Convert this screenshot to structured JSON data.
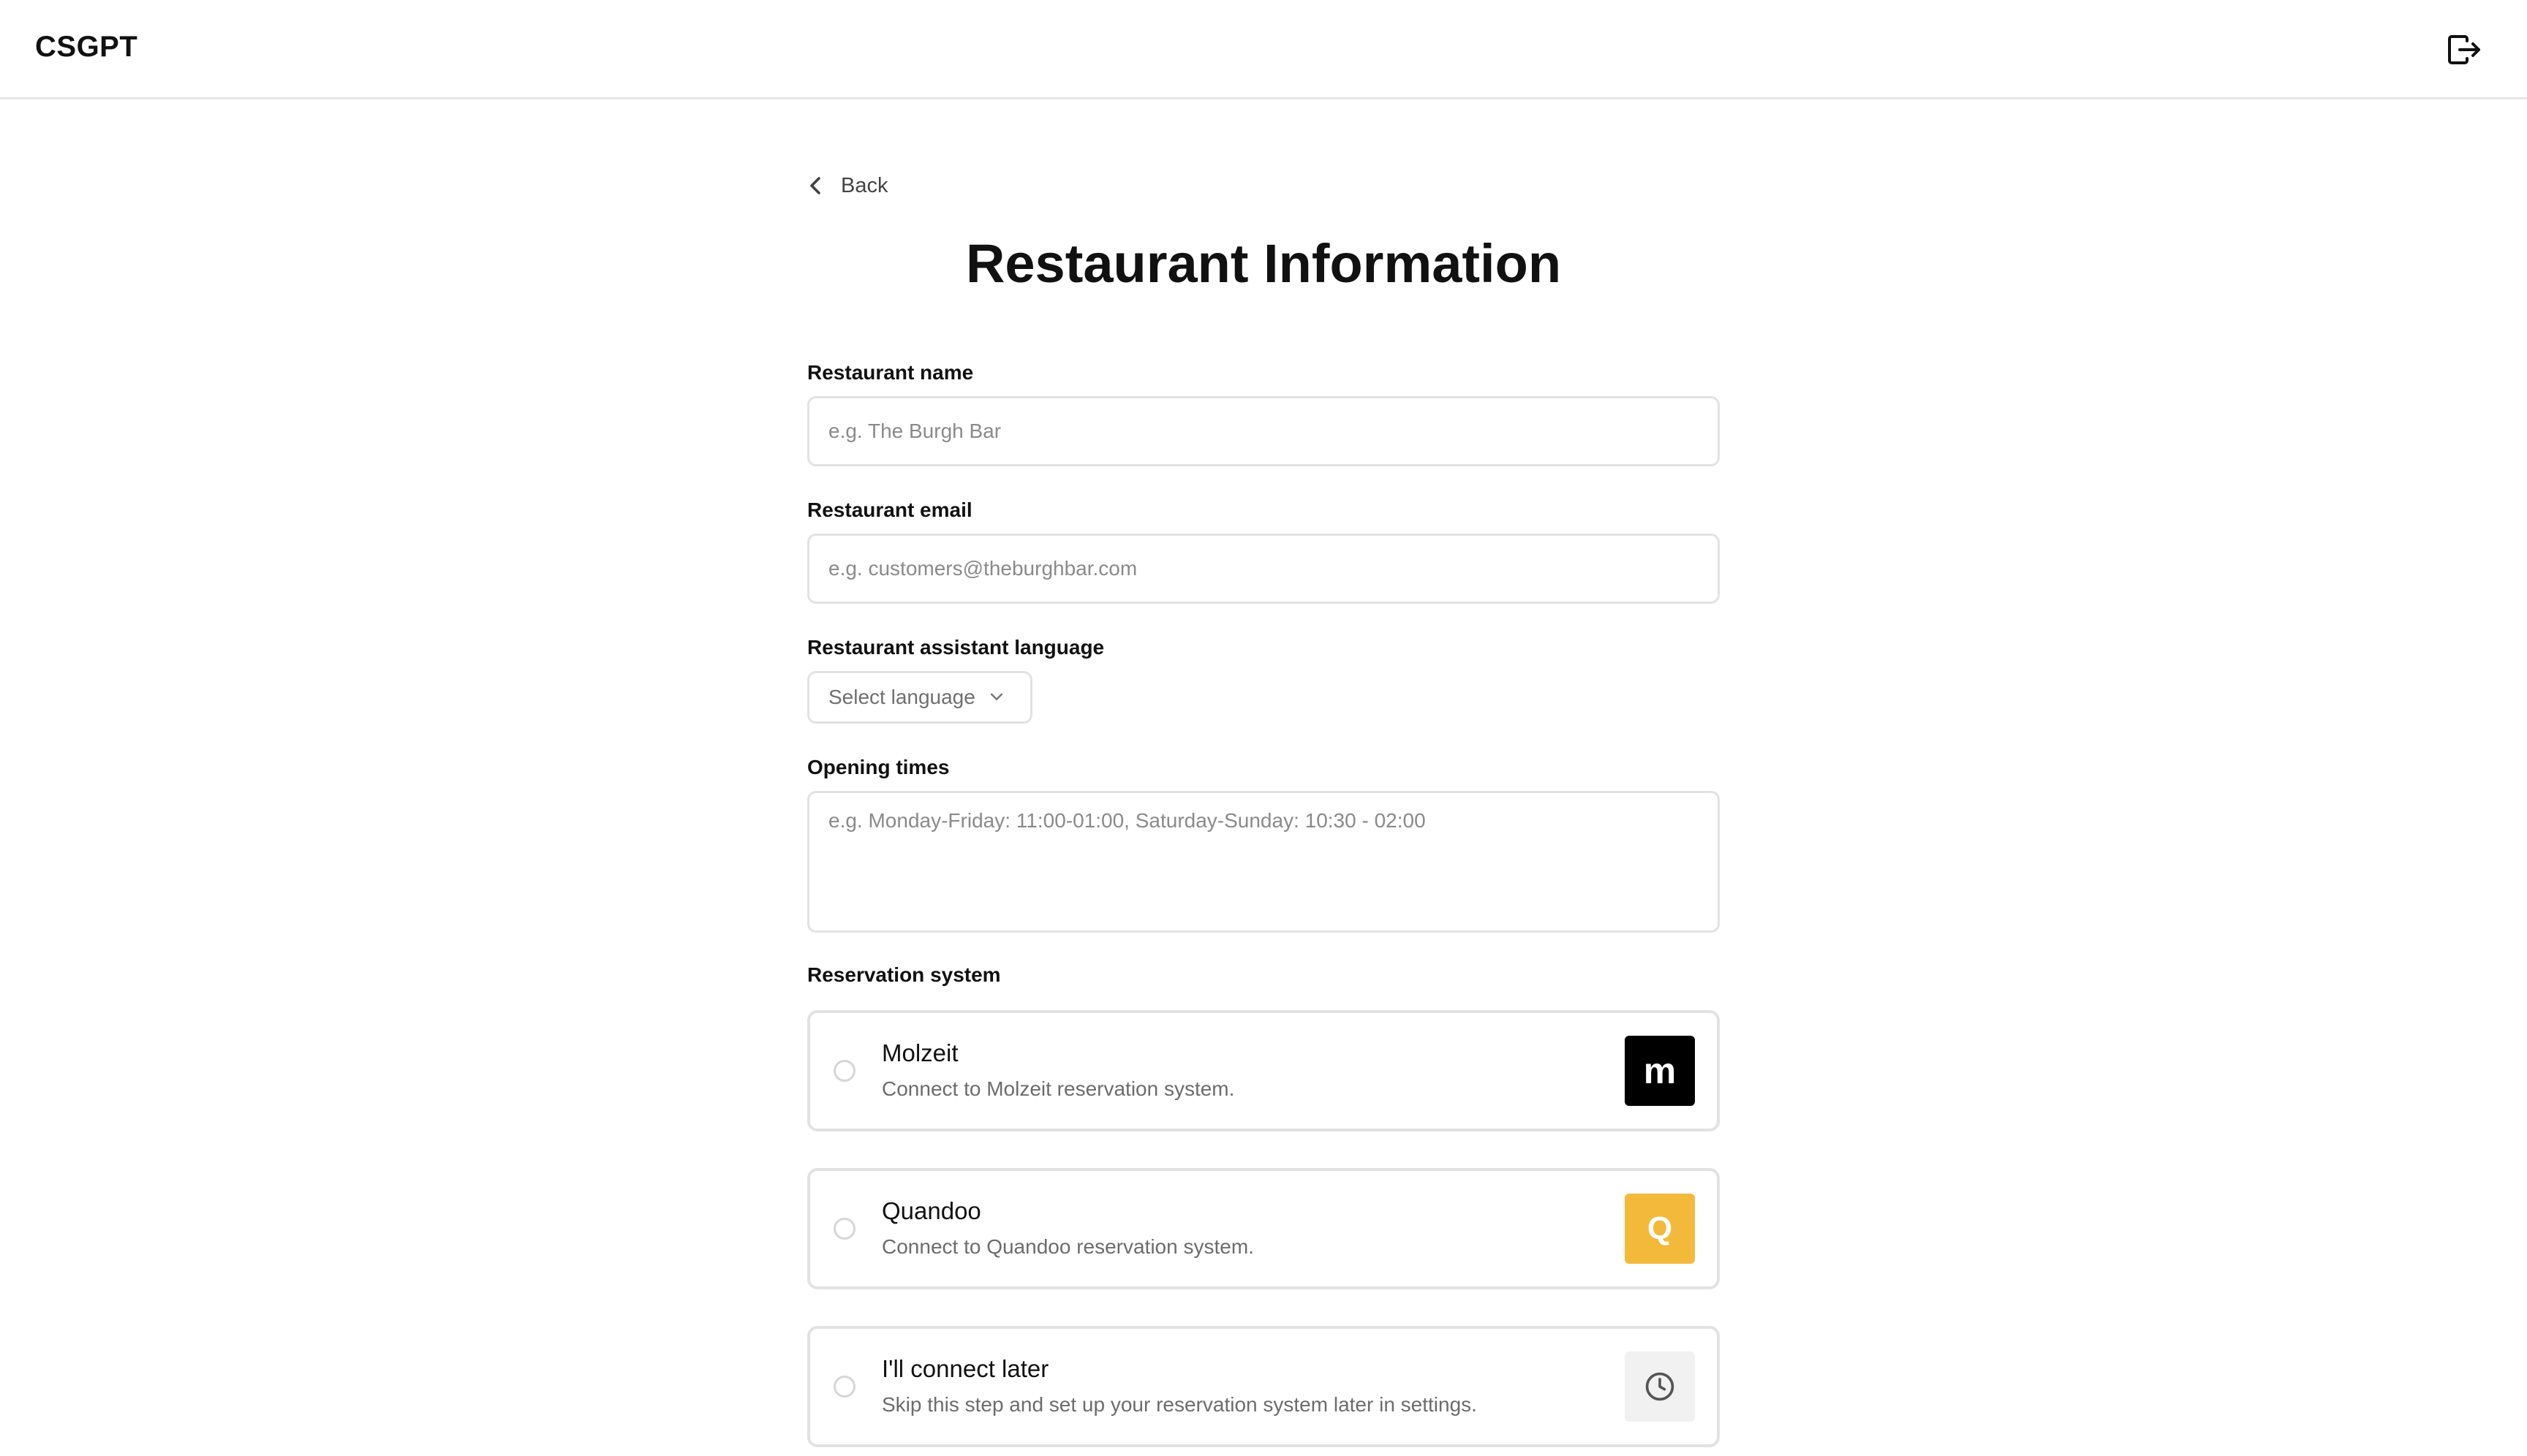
{
  "header": {
    "brand": "CSGPT",
    "logout_icon": "logout-icon"
  },
  "nav": {
    "back_label": "Back"
  },
  "page": {
    "title": "Restaurant Information"
  },
  "form": {
    "name": {
      "label": "Restaurant name",
      "placeholder": "e.g. The Burgh Bar",
      "value": ""
    },
    "email": {
      "label": "Restaurant email",
      "placeholder": "e.g. customers@theburghbar.com",
      "value": ""
    },
    "language": {
      "label": "Restaurant assistant language",
      "selected": "Select language"
    },
    "opening_times": {
      "label": "Opening times",
      "placeholder": "e.g. Monday-Friday: 11:00-01:00, Saturday-Sunday: 10:30 - 02:00",
      "value": ""
    },
    "reservation": {
      "label": "Reservation system",
      "options": [
        {
          "title": "Molzeit",
          "description": "Connect to Molzeit reservation system.",
          "logo": "m",
          "logo_color": "#000000",
          "selected": false
        },
        {
          "title": "Quandoo",
          "description": "Connect to Quandoo reservation system.",
          "logo": "Q",
          "logo_color": "#F2B93B",
          "selected": false
        },
        {
          "title": "I'll connect later",
          "description": "Skip this step and set up your reservation system later in settings.",
          "logo_icon": "clock-icon",
          "selected": false
        }
      ]
    }
  }
}
